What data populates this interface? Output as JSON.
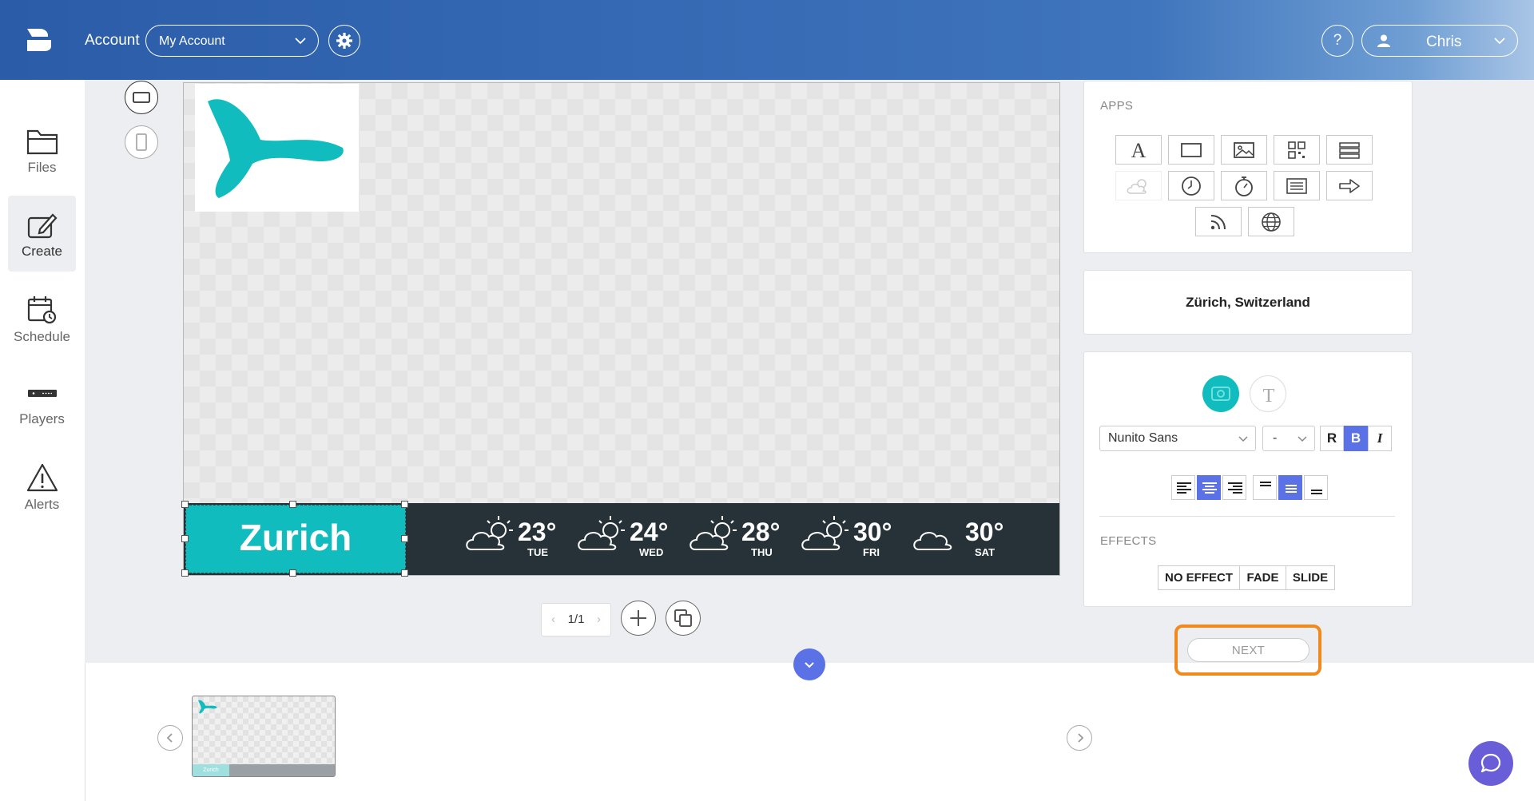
{
  "header": {
    "account_label": "Account",
    "account_select": "My Account",
    "help": "?",
    "user": "Chris"
  },
  "sidebar": {
    "items": [
      {
        "label": "Files",
        "icon": "folder-icon"
      },
      {
        "label": "Create",
        "icon": "edit-icon",
        "active": true
      },
      {
        "label": "Schedule",
        "icon": "calendar-clock-icon"
      },
      {
        "label": "Players",
        "icon": "player-device-icon"
      },
      {
        "label": "Alerts",
        "icon": "alert-icon"
      }
    ]
  },
  "canvas": {
    "city": "Zurich",
    "forecast": [
      {
        "temp": "23°",
        "day": "TUE"
      },
      {
        "temp": "24°",
        "day": "WED"
      },
      {
        "temp": "28°",
        "day": "THU"
      },
      {
        "temp": "30°",
        "day": "FRI"
      },
      {
        "temp": "30°",
        "day": "SAT"
      }
    ]
  },
  "pager": {
    "text": "1/1",
    "prev": "‹",
    "next": "›"
  },
  "thumbnail": {
    "city": "Zurich"
  },
  "apps": {
    "heading": "APPS",
    "icons": [
      "text-icon",
      "rectangle-icon",
      "image-icon",
      "qr-code-icon",
      "table-icon",
      "weather-icon",
      "clock-icon",
      "timer-icon",
      "list-icon",
      "arrow-icon",
      "rss-icon",
      "globe-icon"
    ]
  },
  "location": "Zürich, Switzerland",
  "text_style": {
    "font": "Nunito Sans",
    "size": "-",
    "regular": "R",
    "bold": "B",
    "italic": "I"
  },
  "effects": {
    "heading": "EFFECTS",
    "options": [
      "NO EFFECT",
      "FADE",
      "SLIDE"
    ]
  },
  "next_button": "NEXT",
  "colors": {
    "accent": "#5b72e6",
    "teal": "#10bcbd",
    "highlight": "#f08a1c",
    "weather_bar": "#263238"
  }
}
